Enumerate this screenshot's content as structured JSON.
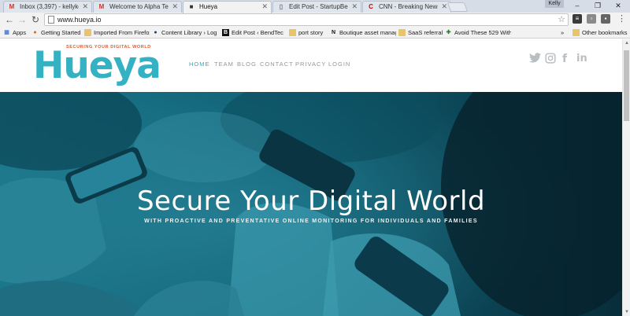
{
  "browser": {
    "tabs": [
      {
        "icon": "gmail-icon",
        "favicon_text": "M",
        "favicon_color": "#d93025",
        "title": "Inbox (3,397) - kellykeardi",
        "active": false
      },
      {
        "icon": "gmail-icon",
        "favicon_text": "M",
        "favicon_color": "#d93025",
        "title": "Welcome to Alpha Team -",
        "active": false
      },
      {
        "icon": "cube-icon",
        "favicon_text": "■",
        "favicon_color": "#333333",
        "title": "Hueya",
        "active": true
      },
      {
        "icon": "document-icon",
        "favicon_text": "▯",
        "favicon_color": "#777777",
        "title": "Edit Post - StartupBend —",
        "active": false
      },
      {
        "icon": "cnn-icon",
        "favicon_text": "C",
        "favicon_color": "#cc0000",
        "title": "CNN - Breaking News, Lat",
        "active": false
      }
    ],
    "user_name": "Kelly",
    "url": "www.hueya.io",
    "bookmarks": [
      {
        "icon": "apps-icon",
        "label": "Apps"
      },
      {
        "icon": "firefox-icon",
        "label": "Getting Started"
      },
      {
        "icon": "folder-icon",
        "label": "Imported From Firefox"
      },
      {
        "icon": "content-library-icon",
        "label": "Content Library › Log"
      },
      {
        "icon": "bendtech-icon",
        "label": "Edit Post ‹ BendTech"
      },
      {
        "icon": "folder-icon",
        "label": "port story"
      },
      {
        "icon": "n-icon",
        "label": "Boutique asset manag"
      },
      {
        "icon": "folder-icon",
        "label": "SaaS referral"
      },
      {
        "icon": "bookmark-icon",
        "label": "Avoid These 529 With"
      }
    ],
    "bookmarks_overflow": "»",
    "other_bookmarks": "Other bookmarks"
  },
  "site": {
    "logo": {
      "tagline": "SECURING YOUR DIGITAL WORLD",
      "wordmark": "Hueya"
    },
    "nav": [
      "HOME",
      "TEAM",
      "BLOG",
      "CONTACT",
      "PRIVACY",
      "LOGIN"
    ],
    "social": [
      {
        "icon": "twitter-icon",
        "glyph": "🐦"
      },
      {
        "icon": "instagram-icon",
        "glyph": "◎"
      },
      {
        "icon": "facebook-icon",
        "glyph": "f"
      },
      {
        "icon": "linkedin-icon",
        "glyph": "in"
      }
    ],
    "hero": {
      "title": "Secure Your Digital World",
      "subtitle": "WITH PROACTIVE AND PREVENTATIVE ONLINE MONITORING FOR INDIVIDUALS AND FAMILIES"
    }
  },
  "colors": {
    "brand_teal": "#34b1c2",
    "brand_orange": "#e2592e",
    "hero_overlay": "#0f5f74"
  }
}
